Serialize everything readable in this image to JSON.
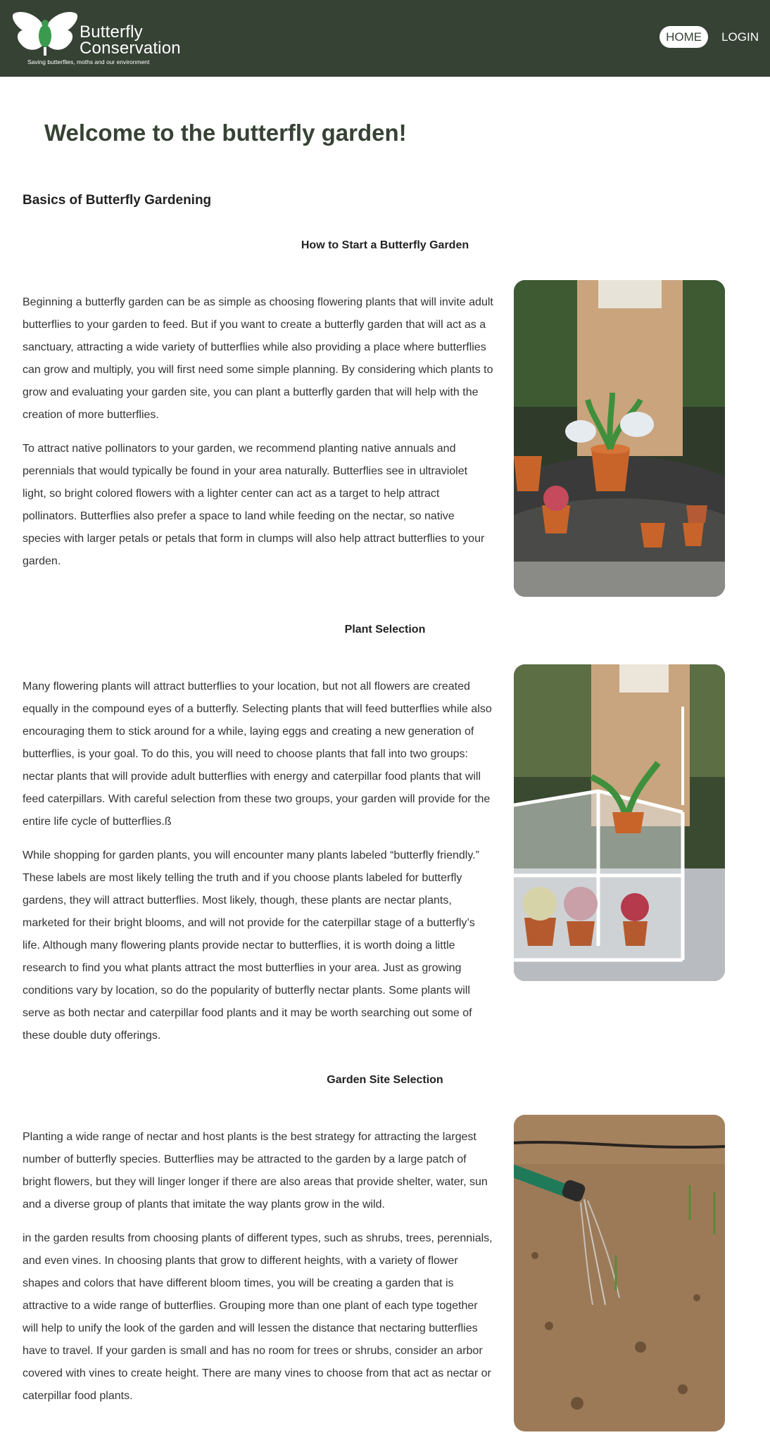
{
  "header": {
    "logo_title_line1": "Butterfly",
    "logo_title_line2": "Conservation",
    "logo_tagline": "Saving butterflies, moths and our environment",
    "nav": {
      "home": "HOME",
      "login": "LOGIN"
    }
  },
  "main": {
    "welcome": "Welcome to the butterfly garden!",
    "basics_heading": "Basics of Butterfly Gardening",
    "sections": [
      {
        "title": "How to Start a Butterfly Garden",
        "paragraphs": [
          "Beginning a butterfly garden can be as simple as choosing flowering plants that will invite adult butterflies to your garden to feed. But if you want to create a butterfly garden that will act as a sanctuary, attracting a wide variety of butterflies while also providing a place where butterflies can grow and multiply, you will first need some simple planning. By considering which plants to grow and evaluating your garden site, you can plant a butterfly garden that will help with the creation of more butterflies.",
          "To attract native pollinators to your garden, we recommend planting native annuals and perennials that would typically be found in your area naturally. Butterflies see in ultraviolet light, so bright colored flowers with a lighter center can act as a target to help attract pollinators. Butterflies also prefer a space to land while feeding on the nectar, so native species with larger petals or petals that form in clumps will also help attract butterflies to your garden."
        ]
      },
      {
        "title": "Plant Selection",
        "paragraphs": [
          "Many flowering plants will attract butterflies to your location, but not all flowers are created equally in the compound eyes of a butterfly. Selecting plants that will feed butterflies while also encouraging them to stick around for a while, laying eggs and creating a new generation of butterflies, is your goal. To do this, you will need to choose plants that fall into two groups: nectar plants that will provide adult butterflies with energy and caterpillar food plants that will feed caterpillars. With careful selection from these two groups, your garden will provide for the entire life cycle of butterflies.ß",
          "While shopping for garden plants, you will encounter many plants labeled “butterfly friendly.” These labels are most likely telling the truth and if you choose plants labeled for butterfly gardens, they will attract butterflies. Most likely, though, these plants are nectar plants, marketed for their bright blooms, and will not provide for the caterpillar stage of a butterfly’s life. Although many flowering plants provide nectar to butterflies, it is worth doing a little research to find you what plants attract the most butterflies in your area. Just as growing conditions vary by location, so do the popularity of butterfly nectar plants. Some plants will serve as both nectar and caterpillar food plants and it may be worth searching out some of these double duty offerings."
        ]
      },
      {
        "title": "Garden Site Selection",
        "paragraphs": [
          "Planting a wide range of nectar and host plants is the best strategy for attracting the largest number of butterfly species. Butterflies may be attracted to the garden by a large patch of bright flowers, but they will linger longer if there are also areas that provide shelter, water, sun and a diverse group of plants that imitate the way plants grow in the wild.",
          "in the garden results from choosing plants of different types, such as shrubs, trees, perennials, and even vines. In choosing plants that grow to different heights, with a variety of flower shapes and colors that have different bloom times, you will be creating a garden that is attractive to a wide range of butterflies. Grouping more than one plant of each type together will help to unify the look of the garden and will lessen the distance that nectaring butterflies have to travel. If your garden is small and has no room for trees or shrubs, consider an arbor covered with vines to create height. There are many vines to choose from that act as nectar or caterpillar food plants."
        ]
      }
    ]
  },
  "colors": {
    "header_bg": "#364234",
    "title_color": "#364234",
    "logo_green": "#3a9a4e"
  }
}
